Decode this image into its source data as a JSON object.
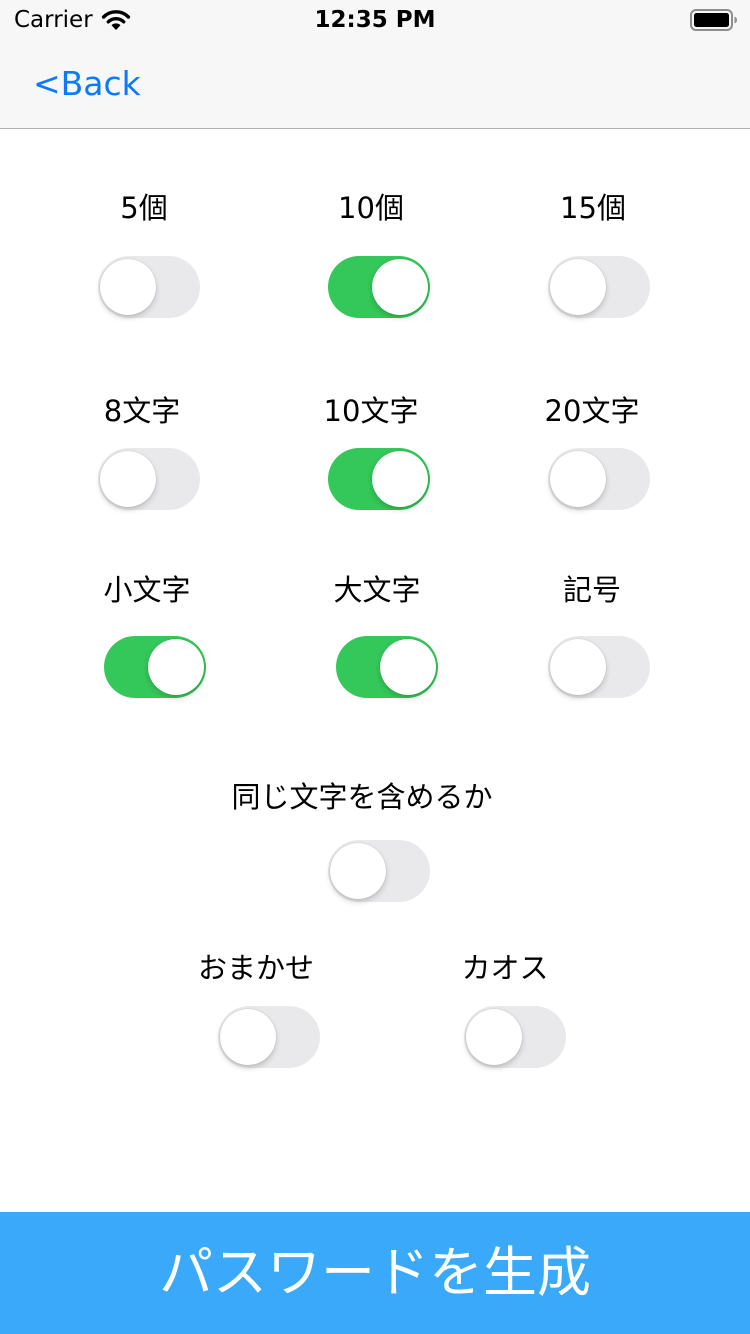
{
  "status_bar": {
    "carrier": "Carrier",
    "time": "12:35 PM",
    "wifi_icon": "wifi-icon",
    "battery_icon": "battery-icon"
  },
  "nav": {
    "back_label": "<Back"
  },
  "count_options": [
    {
      "label": "5個",
      "on": false
    },
    {
      "label": "10個",
      "on": true
    },
    {
      "label": "15個",
      "on": false
    }
  ],
  "length_options": [
    {
      "label": "8文字",
      "on": false
    },
    {
      "label": "10文字",
      "on": true
    },
    {
      "label": "20文字",
      "on": false
    }
  ],
  "charset_options": [
    {
      "label": "小文字",
      "on": true
    },
    {
      "label": "大文字",
      "on": true
    },
    {
      "label": "記号",
      "on": false
    }
  ],
  "same_char_option": {
    "label": "同じ文字を含めるか",
    "on": false
  },
  "mode_options": [
    {
      "label": "おまかせ",
      "on": false
    },
    {
      "label": "カオス",
      "on": false
    }
  ],
  "generate_button": {
    "label": "パスワードを生成"
  },
  "colors": {
    "toggle_on": "#34c759",
    "toggle_off": "#e9e9eb",
    "link": "#0a7aff",
    "generate_background": "#3ba9f9"
  }
}
